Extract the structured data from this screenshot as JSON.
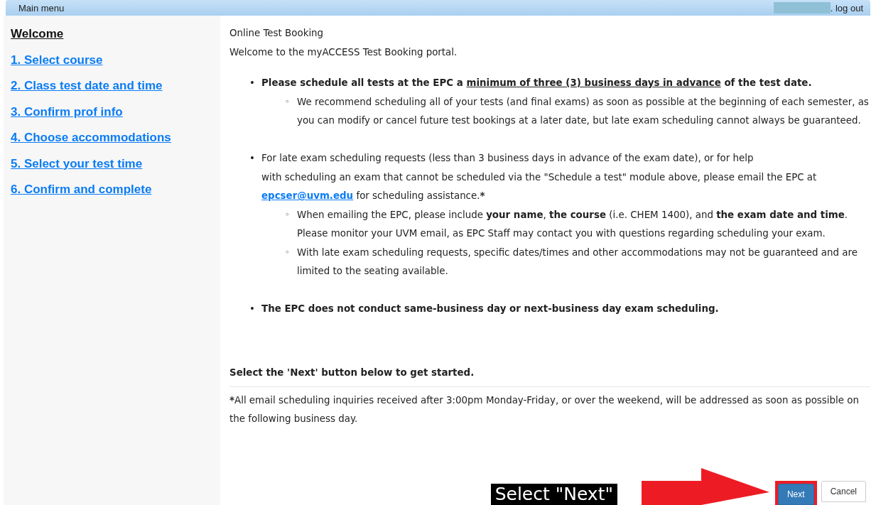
{
  "top_bar": {
    "title": "Main menu",
    "user_redacted": true,
    "logout": ". log out"
  },
  "sidebar": {
    "items": [
      {
        "label": "Welcome",
        "selected": true
      },
      {
        "label": "1. Select course",
        "selected": false
      },
      {
        "label": "2. Class test date and time",
        "selected": false
      },
      {
        "label": "3. Confirm prof info",
        "selected": false
      },
      {
        "label": "4. Choose accommodations",
        "selected": false
      },
      {
        "label": "5. Select your test time",
        "selected": false
      },
      {
        "label": "6. Confirm and complete",
        "selected": false
      }
    ]
  },
  "content": {
    "heading": "Online Test Booking",
    "intro": "Welcome to the myACCESS Test Booking portal.",
    "bullets": [
      {
        "marker": "•",
        "bold": true,
        "before": "Please schedule all tests at the EPC a ",
        "underlined": "minimum of three (3) business days in advance",
        "after": " of the test date.",
        "sub": [
          {
            "marker": "◦",
            "text": "We recommend scheduling all of your tests (and final exams) as soon as possible at the beginning of each semester, as you can modify or cancel future test bookings at a later date, but late exam scheduling cannot always be guaranteed."
          }
        ]
      },
      {
        "marker": "•",
        "bold": false,
        "before": "For late exam scheduling requests (less than 3 business days in advance of the exam date), or for help",
        "line2": "with scheduling an exam that cannot be scheduled via the \"Schedule a test\" module above, please email the EPC at ",
        "link": "epcser@uvm.edu",
        "after": " for scheduling assistance.",
        "mark": "*",
        "sub": [
          {
            "marker": "◦",
            "text": "When emailing the EPC, please include **your name**, **the course** (i.e. CHEM 1400), and **the exam date and time**.  Please monitor your UVM email, as EPC Staff may contact you with questions regarding scheduling your exam."
          },
          {
            "marker": "◦",
            "text": "With late exam scheduling requests, specific dates/times and other accommodations may not be guaranteed and are limited to the seating available."
          }
        ]
      },
      {
        "marker": "•",
        "bold": true,
        "before": "The EPC does not conduct same-business day or next-business day exam scheduling."
      }
    ],
    "prompt": "Select the 'Next' button below to get started.",
    "footnote": {
      "mark": "*",
      "text": "All email scheduling inquiries received after 3:00pm Monday-Friday, or over the weekend, will be addressed as soon as possible on the following business day."
    }
  },
  "buttons": [
    {
      "label": "Next",
      "kind": "primary",
      "highlighted": true
    },
    {
      "label": "Cancel",
      "kind": "default",
      "highlighted": false
    }
  ],
  "annotation": {
    "label": "Select \"Next\"",
    "arrow": true
  }
}
